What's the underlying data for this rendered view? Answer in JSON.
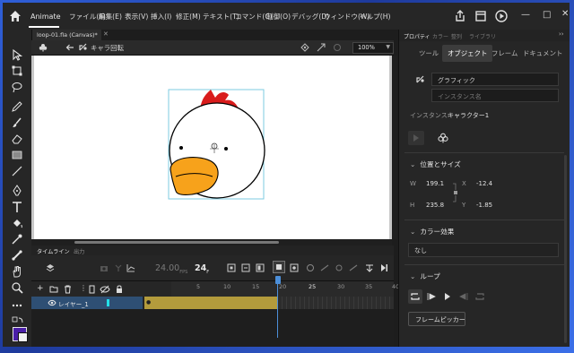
{
  "app": {
    "name": "Animate"
  },
  "menu": [
    "ファイル(F)",
    "編集(E)",
    "表示(V)",
    "挿入(I)",
    "修正(M)",
    "テキスト(T)",
    "コマンド(C)",
    "制御(O)",
    "デバッグ(D)",
    "ウィンドウ(W)",
    "ヘルプ(H)"
  ],
  "document": {
    "tab_title": "loop-01.fla (Canvas)*"
  },
  "stage_bar": {
    "scene_name": "キャラ回転",
    "zoom": "100%"
  },
  "timeline": {
    "tabs": [
      "タイムライン",
      "出力"
    ],
    "fps": "24.00",
    "fps_unit": "FPS",
    "current_frame": "24",
    "frame_unit": "F",
    "ruler": [
      "5",
      "10",
      "15",
      "20",
      "25",
      "30",
      "35",
      "40"
    ],
    "layer_name": "レイヤー_1"
  },
  "panel": {
    "tabs": [
      "プロパティ",
      "カラー",
      "整列",
      "ライブラリ"
    ],
    "subtabs": [
      "ツール",
      "オブジェクト",
      "フレーム",
      "ドキュメント"
    ],
    "active_subtab": "オブジェクト",
    "symbol_type": "グラフィック",
    "instance_name_placeholder": "インスタンス名",
    "instance_label": "インスタンス:",
    "instance_value": "キャラクター1",
    "position_section": "位置とサイズ",
    "w_label": "W",
    "w_value": "199.1",
    "h_label": "H",
    "h_value": "235.8",
    "x_label": "X",
    "x_value": "-12.4",
    "y_label": "Y",
    "y_value": "-1.85",
    "color_effect_section": "カラー効果",
    "color_effect_value": "なし",
    "loop_section": "ループ",
    "frame_picker": "フレームピッカー"
  },
  "colors": {
    "accent": "#4c8fd9",
    "tween": "#b39b3c",
    "layer_color": "#23e0e8",
    "fill": "#4a1fa8"
  }
}
